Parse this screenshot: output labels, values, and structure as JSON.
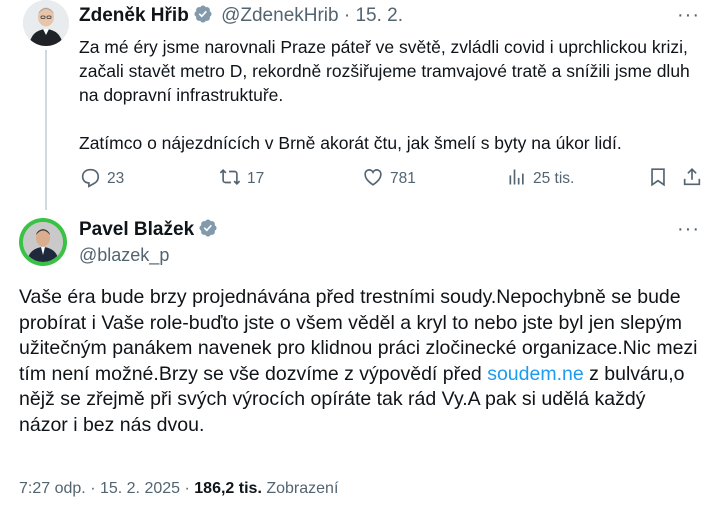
{
  "tweet1": {
    "author_name": "Zdeněk Hřib",
    "handle": "@ZdenekHrib",
    "separator": "·",
    "date": "15. 2.",
    "more": "···",
    "paragraph1": "Za mé éry jsme narovnali Praze páteř ve světě, zvládli covid i uprchlickou krizi, začali stavět metro D, rekordně rozšiřujeme tramvajové tratě a snížili jsme dluh na dopravní infrastruktuře.",
    "paragraph2": "Zatímco o nájezdnících v Brně akorát čtu, jak šmelí s byty na úkor lidí.",
    "replies": "23",
    "reposts": "17",
    "likes": "781",
    "views": "25 tis."
  },
  "tweet2": {
    "author_name": "Pavel Blažek",
    "handle": "@blazek_p",
    "more": "···",
    "body_before_link": "Vaše éra bude brzy projednávána před trestními soudy.Nepochybně se bude probírat  i Vaše role-buďto jste o všem věděl a kryl to nebo jste byl jen slepým užitečným panákem navenek pro klidnou práci zločinecké organizace.Nic mezi tím není možné.Brzy se vše dozvíme z výpovědí před ",
    "link_text": "soudem.ne",
    "body_after_link": " z bulváru,o nějž se zřejmě při svých výrocích  opíráte tak rád Vy.A pak si udělá každý názor i bez nás dvou.",
    "time": "7:27 odp.",
    "sep1": "·",
    "date": "15. 2. 2025",
    "sep2": "·",
    "view_count": "186,2 tis.",
    "view_label": "Zobrazení"
  },
  "colors": {
    "link": "#1d9bf0",
    "verified": "#829aab",
    "muted": "#536471",
    "avatar_ring": "#39c244"
  },
  "icons": [
    "reply-icon",
    "repost-icon",
    "like-icon",
    "views-icon",
    "bookmark-icon",
    "share-icon",
    "verified-badge-icon",
    "more-icon"
  ]
}
